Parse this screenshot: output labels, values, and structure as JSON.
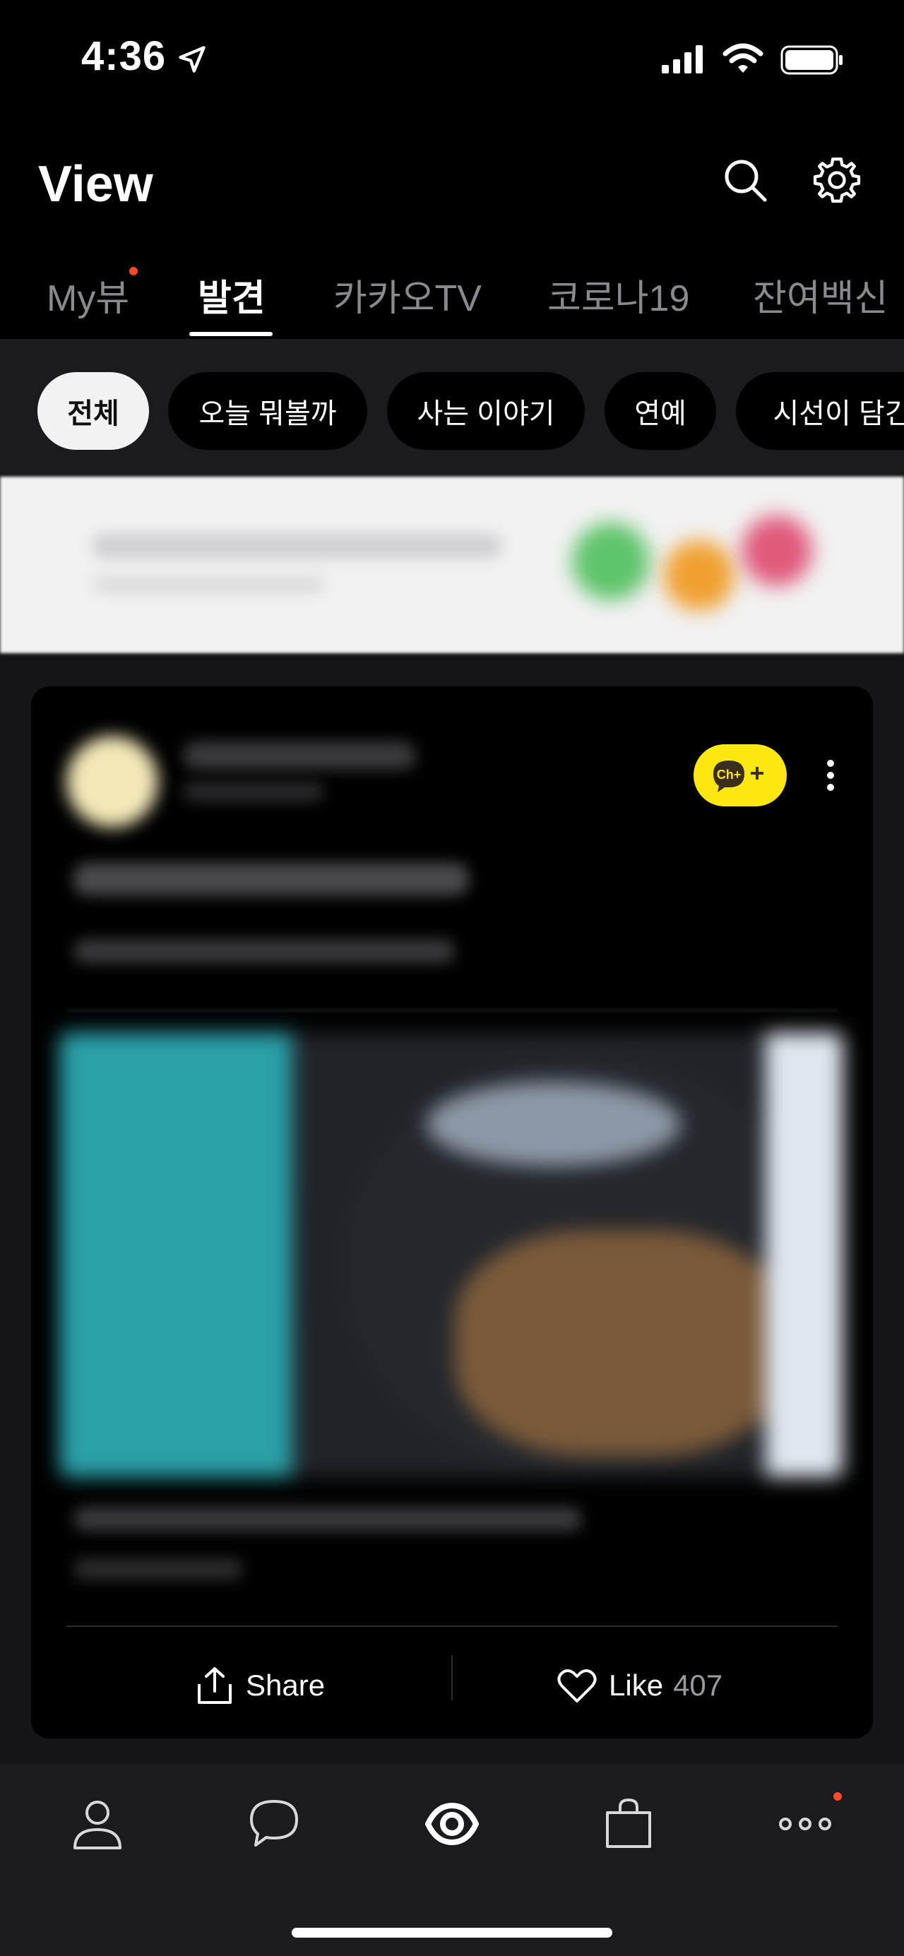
{
  "status_bar": {
    "time": "4:36"
  },
  "header": {
    "title": "View"
  },
  "tabs": [
    {
      "label": "My뷰",
      "has_dot": true
    },
    {
      "label": "발견",
      "active": true
    },
    {
      "label": "카카오TV"
    },
    {
      "label": "코로나19"
    },
    {
      "label": "잔여백신"
    }
  ],
  "chips": [
    {
      "label": "전체",
      "active": true
    },
    {
      "label": "오늘 뭐볼까"
    },
    {
      "label": "사는 이야기"
    },
    {
      "label": "연예"
    },
    {
      "label": "시선이 담긴"
    }
  ],
  "card": {
    "channel_button": "Ch+",
    "actions": {
      "share": "Share",
      "like": "Like",
      "like_count": "407"
    }
  },
  "bottom_nav": [
    "person-icon",
    "chat-icon",
    "view-icon",
    "shopping-bag-icon",
    "more-icon"
  ],
  "colors": {
    "accent_yellow": "#ffe812",
    "notification_dot": "#ff4a2a",
    "background": "#151517"
  }
}
